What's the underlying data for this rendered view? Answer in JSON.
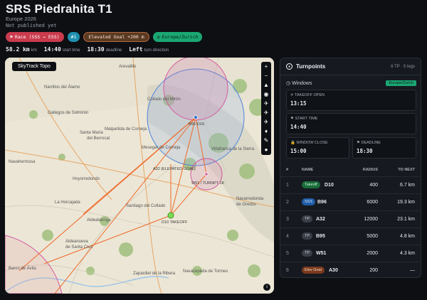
{
  "header": {
    "title": "SRS Piedrahita T1",
    "subtitle": "Europe 2026",
    "status": "Not published yet"
  },
  "badges": {
    "race": "Race (SSS → ESS)",
    "number": "#1",
    "goal": "Elevated Goal +200 m",
    "timezone": "Europe/Zurich"
  },
  "stats": {
    "distance_value": "58.2 km",
    "distance_label": "km",
    "start_value": "14:40",
    "start_label": "start time",
    "deadline_value": "18:30",
    "deadline_label": "deadline",
    "turn_value": "Left",
    "turn_label": "turn direction"
  },
  "map": {
    "layer_label": "SkyTrack Topo",
    "places": [
      "Arevalillo",
      "Narrillos del Álamo",
      "Gallegos de Solmirón",
      "Santa María del Berrocal",
      "Navahermosa",
      "Collado del Mirón",
      "Horcajo de la Ribera",
      "Medinilla",
      "Malpartida de Corneja",
      "Mesegar de Corneja",
      "Casas del Puerto",
      "Villafranca de la Sierra",
      "Navalperal de Tormes",
      "Hoyorredondo",
      "Bohoyo",
      "Navamorales",
      "Santiago del Collado",
      "La Horcajada",
      "Aldealuenga",
      "Aldeanueva de Santa Cruz",
      "Barco de Ávila",
      "Zapardiel de la Ribera",
      "Navacepeda de Tormes",
      "Navadijos",
      "Navarredonda de Gredos",
      "Hoyos del Espino",
      "San Martín del Pimpollar"
    ],
    "waypoints": [
      "A32 (ELEVATED GOAL)",
      "W51 / TURNPT 1K",
      "D10 TAKEOFF",
      "B96 ESS"
    ],
    "tools": [
      "+",
      "−",
      "▲",
      "◉",
      "✈",
      "✈",
      "✈",
      "♦",
      "✎",
      "●"
    ],
    "info": "i"
  },
  "panel": {
    "title": "Turnpoints",
    "count": "6 TP · 5 legs",
    "windows_title": "Windows",
    "windows_tz": "Europe/Zurich",
    "cards": [
      {
        "label": "Takeoff open",
        "value": "13:15"
      },
      {
        "label": "Start time",
        "value": "14:40"
      },
      {
        "label": "Window close",
        "value": "15:00"
      },
      {
        "label": "Deadline",
        "value": "18:30"
      }
    ],
    "columns": {
      "idx": "#",
      "name": "NAME",
      "radius": "RADIUS",
      "next": "TO NEXT"
    },
    "rows": [
      {
        "idx": "1",
        "tag": "Takeoff",
        "name": "D10",
        "radius": "400",
        "next": "6.7 km"
      },
      {
        "idx": "2",
        "tag": "SSS",
        "name": "B96",
        "radius": "6000",
        "next": "19.3 km"
      },
      {
        "idx": "3",
        "tag": "TP",
        "name": "A32",
        "radius": "12000",
        "next": "23.1 km"
      },
      {
        "idx": "4",
        "tag": "TP",
        "name": "B95",
        "radius": "5000",
        "next": "4.8 km"
      },
      {
        "idx": "5",
        "tag": "TP",
        "name": "W51",
        "radius": "2000",
        "next": "4.3 km"
      },
      {
        "idx": "6",
        "tag": "Elev Goal",
        "name": "A30",
        "radius": "200",
        "next": "—"
      }
    ]
  }
}
